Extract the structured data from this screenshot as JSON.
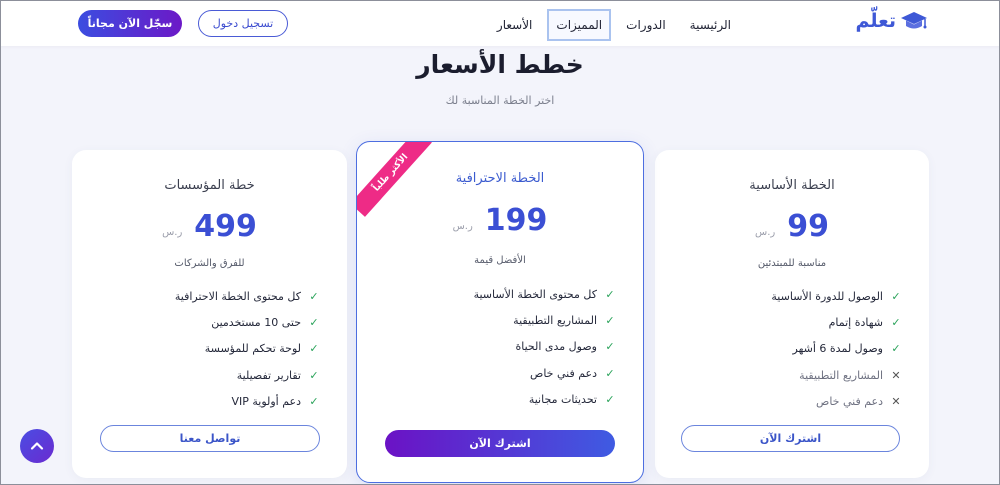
{
  "nav": {
    "logo_text": "تعلّم",
    "links": [
      "الرئيسية",
      "الدورات",
      "المميزات",
      "الأسعار"
    ],
    "active_link": "المميزات",
    "login_label": "تسجيل دخول",
    "signup_label": "سجّل الآن مجاناً"
  },
  "header": {
    "title": "خطط الأسعار",
    "subtitle": "اختر الخطة المناسبة لك"
  },
  "plans": {
    "basic": {
      "name": "الخطة الأساسية",
      "price": "99",
      "currency": "ر.س",
      "description": "مناسبة للمبتدئين",
      "features": [
        {
          "text": "الوصول للدورة الأساسية",
          "included": true
        },
        {
          "text": "شهادة إتمام",
          "included": true
        },
        {
          "text": "وصول لمدة 6 أشهر",
          "included": true
        },
        {
          "text": "المشاريع التطبيقية",
          "included": false
        },
        {
          "text": "دعم فني خاص",
          "included": false
        }
      ],
      "cta": "اشترك الآن"
    },
    "pro": {
      "badge": "الأكثر طلباً",
      "name": "الخطة الاحترافية",
      "price": "199",
      "currency": "ر.س",
      "description": "الأفضل قيمة",
      "features": [
        {
          "text": "كل محتوى الخطة الأساسية",
          "included": true
        },
        {
          "text": "المشاريع التطبيقية",
          "included": true
        },
        {
          "text": "وصول مدى الحياة",
          "included": true
        },
        {
          "text": "دعم فني خاص",
          "included": true
        },
        {
          "text": "تحديثات مجانية",
          "included": true
        }
      ],
      "cta": "اشترك الآن"
    },
    "enterprise": {
      "name": "خطة المؤسسات",
      "price": "499",
      "currency": "ر.س",
      "description": "للفرق والشركات",
      "features": [
        {
          "text": "كل محتوى الخطة الاحترافية",
          "included": true
        },
        {
          "text": "حتى 10 مستخدمين",
          "included": true
        },
        {
          "text": "لوحة تحكم للمؤسسة",
          "included": true
        },
        {
          "text": "تقارير تفصيلية",
          "included": true
        },
        {
          "text": "دعم أولوية VIP",
          "included": true
        }
      ],
      "cta": "تواصل معنا"
    }
  },
  "icons": {
    "check": "check-icon",
    "cross": "cross-icon",
    "scroll_top": "arrow-up-icon",
    "logo": "graduation-cap-icon"
  },
  "colors": {
    "brand": "#3b4fd4",
    "badge": "#ee2b86",
    "check": "#2aa35a",
    "gradient_start": "#3b4de0",
    "gradient_end": "#6c19c7"
  }
}
